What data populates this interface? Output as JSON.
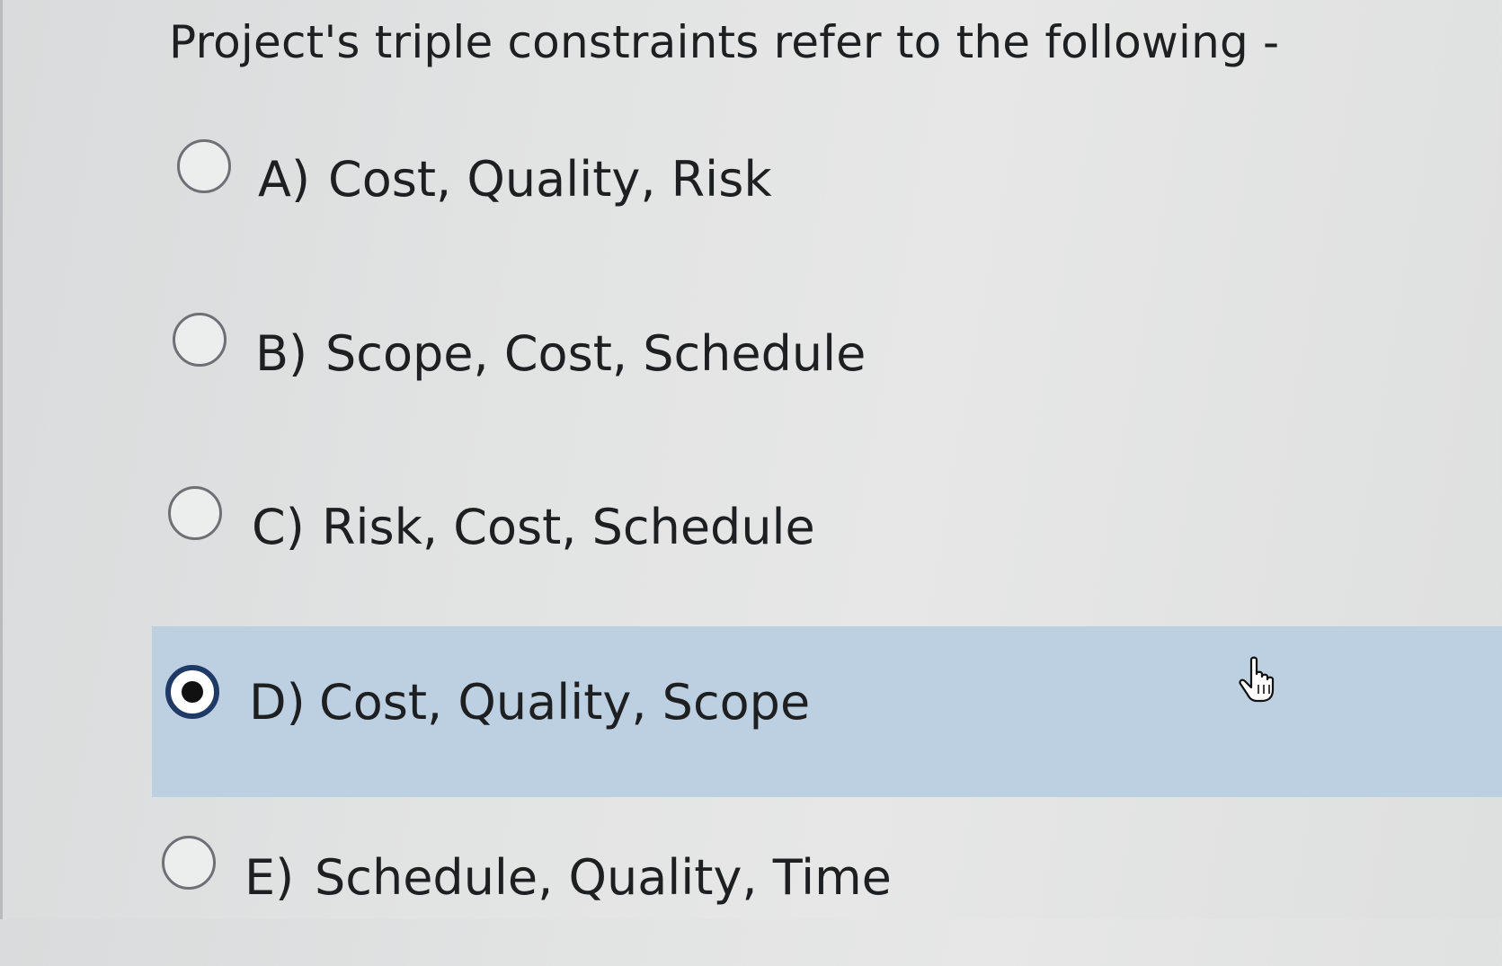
{
  "question": {
    "text": "Project's triple constraints refer to the following -"
  },
  "options": [
    {
      "letter": "A)",
      "text": "Cost, Quality, Risk",
      "selected": false
    },
    {
      "letter": "B)",
      "text": "Scope, Cost, Schedule",
      "selected": false
    },
    {
      "letter": "C)",
      "text": "Risk, Cost, Schedule",
      "selected": false
    },
    {
      "letter": "D)",
      "text": "Cost, Quality, Scope",
      "selected": true
    },
    {
      "letter": "E)",
      "text": "Schedule, Quality, Time",
      "selected": false
    }
  ],
  "cursor": {
    "icon": "hand-pointer-icon"
  },
  "colors": {
    "highlight": "#bdd0e2",
    "radio_selected_ring": "#1f3a66",
    "text": "#1e1f21"
  }
}
